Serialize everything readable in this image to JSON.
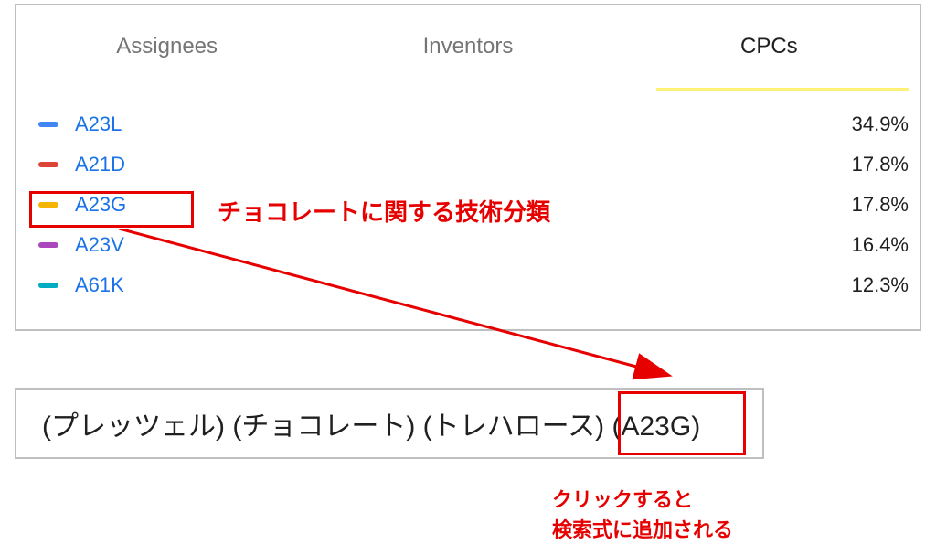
{
  "tabs": {
    "assignees": "Assignees",
    "inventors": "Inventors",
    "cpcs": "CPCs"
  },
  "cpc_rows": [
    {
      "code": "A23L",
      "pct": "34.9%",
      "color": "#4285f4"
    },
    {
      "code": "A21D",
      "pct": "17.8%",
      "color": "#db4437"
    },
    {
      "code": "A23G",
      "pct": "17.8%",
      "color": "#f4b400"
    },
    {
      "code": "A23V",
      "pct": "16.4%",
      "color": "#ab47bc"
    },
    {
      "code": "A61K",
      "pct": "12.3%",
      "color": "#00acc1"
    }
  ],
  "annotation": {
    "label1": "チョコレートに関する技術分類",
    "label2_line1": "クリックすると",
    "label2_line2": "検索式に追加される"
  },
  "search": {
    "term1": "(プレッツェル) ",
    "term2": "(チョコレート) ",
    "term3": "(トレハロース) ",
    "term4": "(A23G)"
  },
  "colors": {
    "highlight": "#e60000",
    "tab_underline": "#fff176",
    "link": "#1a73e8"
  }
}
